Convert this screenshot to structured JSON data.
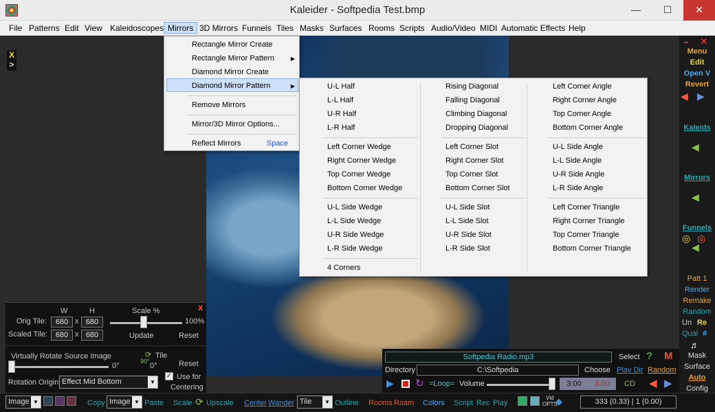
{
  "window": {
    "title": "Kaleider - Softpedia Test.bmp",
    "minimize": "—",
    "maximize": "☐",
    "close": "✕"
  },
  "menubar": [
    "File",
    "Patterns",
    "Edit",
    "View",
    "Kaleidoscopes",
    "Mirrors",
    "3D Mirrors",
    "Funnels",
    "Tiles",
    "Masks",
    "Surfaces",
    "Rooms",
    "Scripts",
    "Audio/Video",
    "MIDI",
    "Automatic Effects",
    "Help"
  ],
  "left_toggle": {
    "x": "X",
    "gt": ">"
  },
  "mirrors_menu": {
    "items": [
      "Rectangle Mirror Create",
      "Rectangle Mirror Pattern",
      "Diamond Mirror Create",
      "Diamond Mirror Pattern",
      "Remove Mirrors",
      "Mirror/3D Mirror Options...",
      "Reflect Mirrors"
    ],
    "shortcut": "Space"
  },
  "diamond_submenu": {
    "col1": [
      "U-L Half",
      "L-L Half",
      "U-R Half",
      "L-R Half",
      "Left Corner Wedge",
      "Right Corner Wedge",
      "Top Corner Wedge",
      "Bottom Corner Wedge",
      "U-L Side Wedge",
      "L-L Side Wedge",
      "U-R Side Wedge",
      "L-R Side Wedge",
      "4 Corners"
    ],
    "col2": [
      "Rising Diagonal",
      "Falling Diagonal",
      "Climbing Diagonal",
      "Dropping Diagonal",
      "Left Corner Slot",
      "Right Corner Slot",
      "Top Corner Slot",
      "Bottom Corner Slot",
      "U-L Side Slot",
      "L-L Side Slot",
      "U-R Side Slot",
      "L-R Side Slot"
    ],
    "col3": [
      "Left Corner Angle",
      "Right Corner Angle",
      "Top Corner Angle",
      "Bottom Corner Angle",
      "U-L Side Angle",
      "L-L Side Angle",
      "U-R Side Angle",
      "L-R Side Angle",
      "Left Corner Triangle",
      "Right Corner Triangle",
      "Top Corner Triangle",
      "Bottom Corner Triangle"
    ]
  },
  "right_panel": {
    "menu": "Menu",
    "edit": "Edit",
    "open": "Open V",
    "revert": "Revert",
    "kaleids": "Kaleids",
    "mirrors": "Mirrors",
    "funnels": "Funnels",
    "patt": "Patt 1",
    "render": "Render",
    "remake": "Remake",
    "random": "Random",
    "un": "Un",
    "re": "Re",
    "qual": "Qual",
    "hash": "#",
    "mask": "Mask",
    "surface": "Surface",
    "auto": "Auto",
    "config": "Config"
  },
  "tile_panel": {
    "w": "W",
    "h": "H",
    "scale_label": "Scale %",
    "close": "X",
    "orig_label": "Orig Tile:",
    "orig_w": "680",
    "orig_h": "680",
    "scaled_label": "Scaled Tile:",
    "scaled_w": "680",
    "scaled_h": "680",
    "times": "x",
    "scale_pct": "100%",
    "update": "Update",
    "reset": "Reset",
    "scale_value": 100,
    "rotate_label": "Virtually Rotate Source Image",
    "rotate_deg": "0°",
    "tile_label": "Tile",
    "tile_90": "90°",
    "tile_deg": "0°",
    "reset2": "Reset",
    "origin_label": "Rotation Origin",
    "origin_value": "Effect Mid Bottom",
    "use_for": "Use for",
    "centering": "Centering",
    "use_checked": true
  },
  "media": {
    "file": "Softpedia Radio.mp3",
    "select": "Select",
    "m": "M",
    "dir_label": "Directory",
    "dir": "C:\\Softpedia",
    "choose": "Choose",
    "play_dir": "Play Dir",
    "random": "Random",
    "loop": "=Loop=",
    "volume": "Volume",
    "t1": "3:00",
    "t2": "3:00",
    "cd": "CD",
    "question": "?"
  },
  "statusbar": {
    "image1": "Image",
    "copy": "Copy",
    "image2": "Image",
    "paste": "Paste",
    "scale": "Scale",
    "upscale": "Upscale",
    "center": "Center",
    "wander": "Wander",
    "tile": "Tile",
    "outline": "Outline",
    "rooms": "Rooms",
    "roam": "Roam",
    "colors": "Colors",
    "script": "Script",
    "rec": "Rec",
    "play": "Play",
    "vid": "Vid",
    "opts": "OPTS",
    "readout": "333 (0.33) | 1 (0.00)",
    "help": "?"
  },
  "colors": {
    "accent": "#2aa6b0",
    "orange": "#e8a23a",
    "blue": "#3f8fd8"
  }
}
